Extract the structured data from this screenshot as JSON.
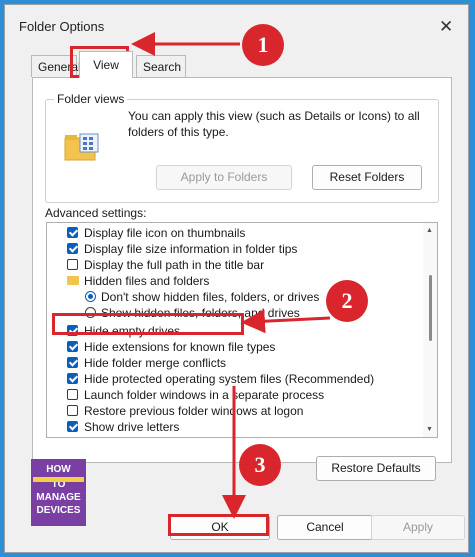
{
  "window": {
    "title": "Folder Options",
    "close_glyph": "✕"
  },
  "tabs": [
    {
      "label": "General"
    },
    {
      "label": "View"
    },
    {
      "label": "Search"
    }
  ],
  "folder_views": {
    "heading": "Folder views",
    "description": "You can apply this view (such as Details or Icons) to all folders of this type.",
    "apply_button": "Apply to Folders",
    "reset_button": "Reset Folders"
  },
  "advanced": {
    "label": "Advanced settings:",
    "items": [
      {
        "text": "Display file icon on thumbnails",
        "kind": "checkbox",
        "checked": true
      },
      {
        "text": "Display file size information in folder tips",
        "kind": "checkbox",
        "checked": true
      },
      {
        "text": "Display the full path in the title bar",
        "kind": "checkbox",
        "checked": false
      },
      {
        "text": "Hidden files and folders",
        "kind": "folder"
      },
      {
        "text": "Don't show hidden files, folders, or drives",
        "kind": "radio",
        "checked": true
      },
      {
        "text": "Show hidden files, folders, and drives",
        "kind": "radio",
        "checked": false
      },
      {
        "text": "Hide empty drives",
        "kind": "checkbox",
        "checked": true
      },
      {
        "text": "Hide extensions for known file types",
        "kind": "checkbox",
        "checked": true
      },
      {
        "text": "Hide folder merge conflicts",
        "kind": "checkbox",
        "checked": true
      },
      {
        "text": "Hide protected operating system files (Recommended)",
        "kind": "checkbox",
        "checked": true
      },
      {
        "text": "Launch folder windows in a separate process",
        "kind": "checkbox",
        "checked": false
      },
      {
        "text": "Restore previous folder windows at logon",
        "kind": "checkbox",
        "checked": false
      },
      {
        "text": "Show drive letters",
        "kind": "checkbox",
        "checked": true
      }
    ],
    "restore_button": "Restore Defaults"
  },
  "footer": {
    "ok": "OK",
    "cancel": "Cancel",
    "apply": "Apply"
  },
  "logo": {
    "line1": "HOW",
    "line2": "TO",
    "line3": "MANAGE",
    "line4": "DEVICES"
  },
  "callouts": [
    "1",
    "2",
    "3"
  ],
  "colors": {
    "accent": "#0a5fbd",
    "callout": "#d9262c",
    "background": "#2d8fd6"
  }
}
